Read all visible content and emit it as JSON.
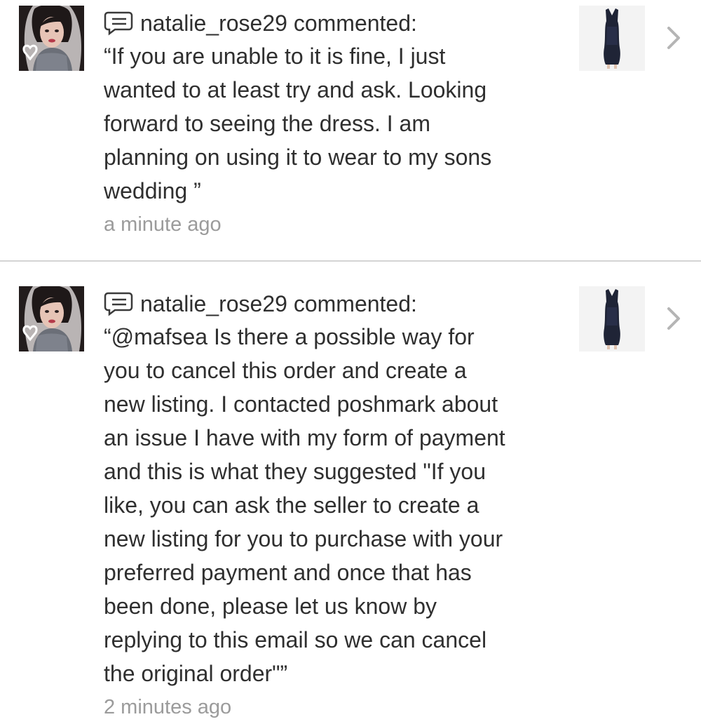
{
  "notifications": [
    {
      "username": "natalie_rose29",
      "action": "commented:",
      "comment": "“If you are unable to it is fine, I just\nwanted to at least try and ask. Looking\nforward to seeing the dress. I am\nplanning on using it to wear to my sons\nwedding ”",
      "timestamp": "a minute ago",
      "avatar_icon": "user-avatar-photo",
      "thumbnail_icon": "dress-thumbnail"
    },
    {
      "username": "natalie_rose29",
      "action": "commented:",
      "comment": "“@mafsea Is there a possible way for\nyou to cancel this order and create a\nnew listing. I contacted poshmark about\nan issue I have with my form of payment\nand this is what they suggested \"If you\nlike, you can ask the seller to create a\nnew listing for you to purchase with your\npreferred payment and once that has\nbeen done, please let us know by\nreplying to this email so we can cancel\nthe original order\"”",
      "timestamp": "2 minutes ago",
      "avatar_icon": "user-avatar-photo",
      "thumbnail_icon": "dress-thumbnail"
    }
  ],
  "colors": {
    "text": "#2f2f2f",
    "muted": "#9b9b9b",
    "divider": "#d4d4d4",
    "chevron": "#b5b5b5"
  }
}
